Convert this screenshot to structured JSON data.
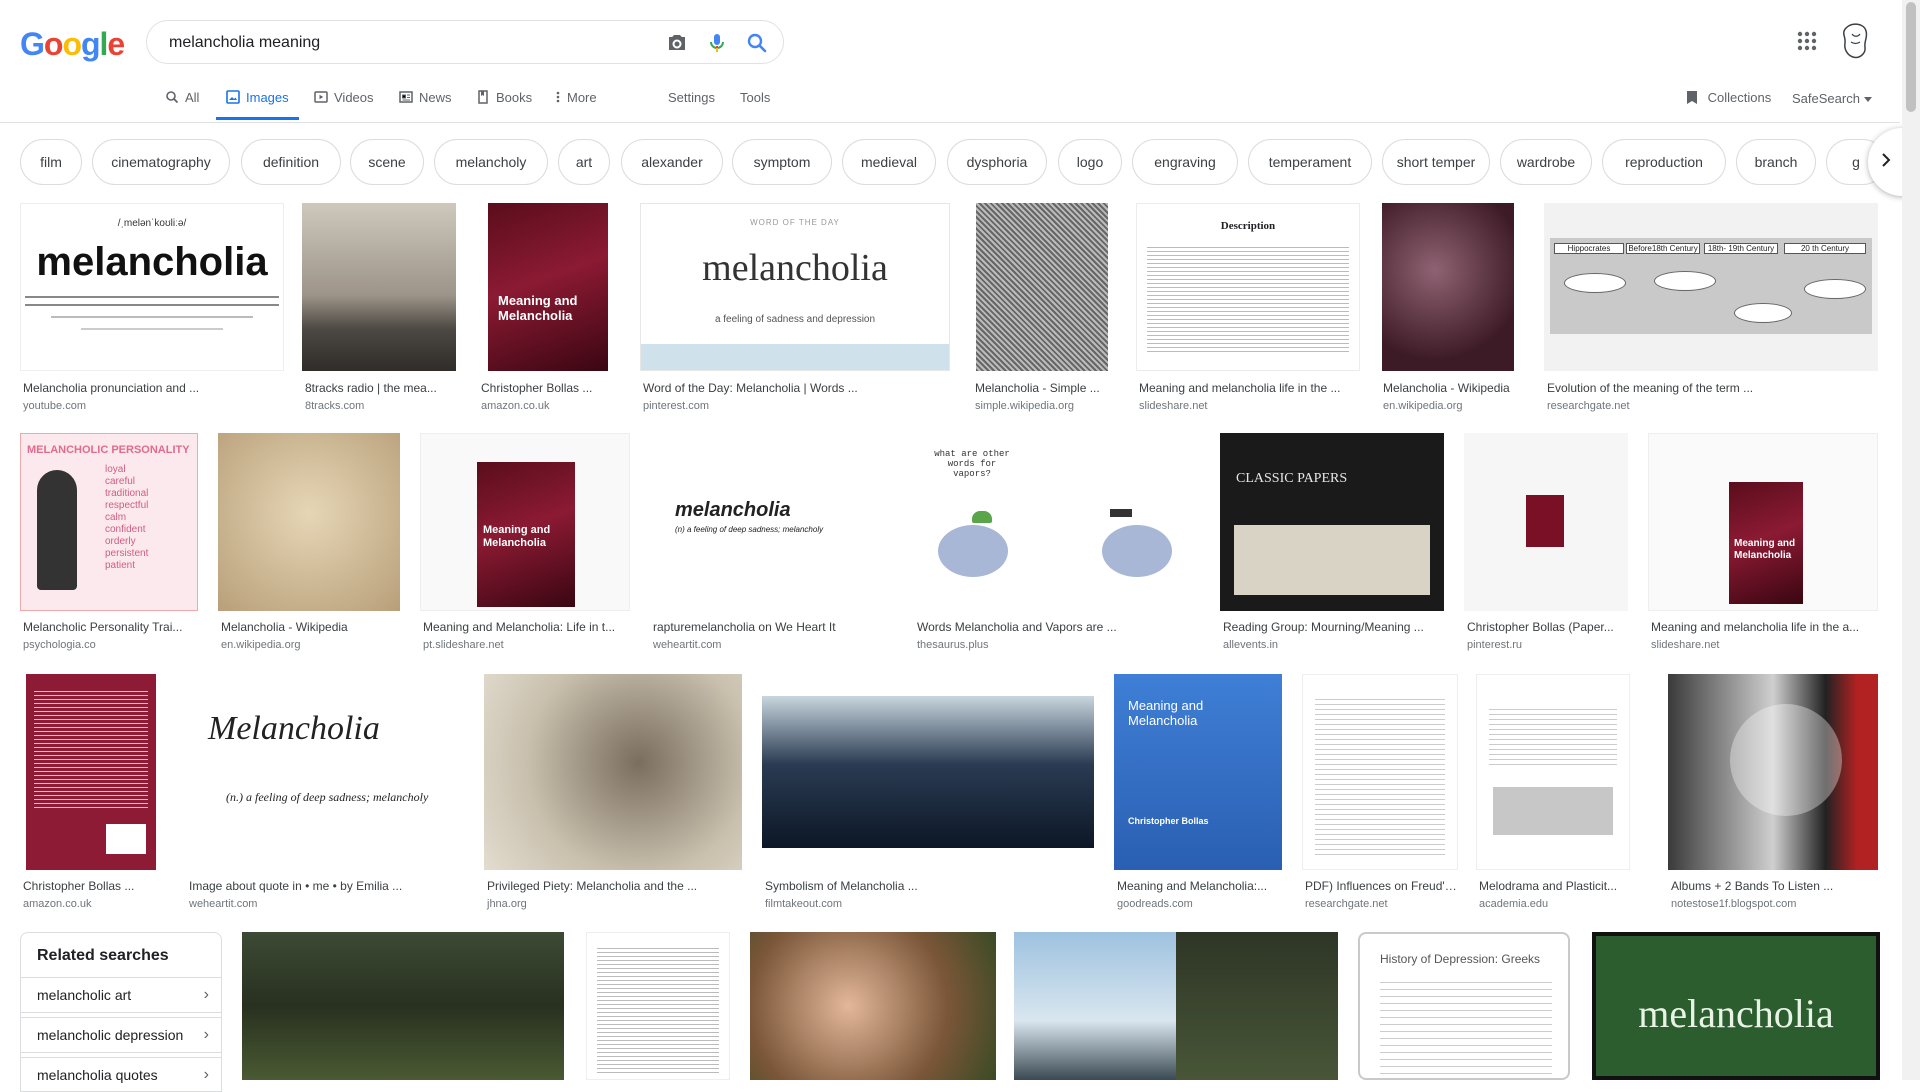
{
  "header": {
    "logo_letters": [
      "G",
      "o",
      "o",
      "g",
      "l",
      "e"
    ],
    "logo_colors": [
      "#4285f4",
      "#ea4335",
      "#fbbc05",
      "#4285f4",
      "#34a853",
      "#ea4335"
    ],
    "search_value": "melancholia meaning",
    "tabs": [
      {
        "label": "All",
        "icon": "search-icon"
      },
      {
        "label": "Images",
        "icon": "image-icon",
        "active": true
      },
      {
        "label": "Videos",
        "icon": "video-icon"
      },
      {
        "label": "News",
        "icon": "news-icon"
      },
      {
        "label": "Books",
        "icon": "book-icon"
      },
      {
        "label": "More",
        "icon": "more-vert-icon"
      }
    ],
    "settings": "Settings",
    "tools": "Tools",
    "collections": "Collections",
    "safesearch": "SafeSearch"
  },
  "chips": [
    "film",
    "cinematography",
    "definition",
    "scene",
    "melancholy",
    "art",
    "alexander",
    "symptom",
    "medieval",
    "dysphoria",
    "logo",
    "engraving",
    "temperament",
    "short temper",
    "wardrobe",
    "reproduction",
    "branch",
    "g"
  ],
  "images": [
    {
      "caption": "Melancholia pronunciation and ...",
      "source": "youtube.com",
      "thumb_text": "melancholia",
      "thumb_sub": "/ˌmelənˈkoʊliːə/"
    },
    {
      "caption": "8tracks radio | the mea...",
      "source": "8tracks.com"
    },
    {
      "caption": "Christopher Bollas ...",
      "source": "amazon.co.uk",
      "thumb_text": "Meaning and Melancholia"
    },
    {
      "caption": "Word of the Day: Melancholia | Words ...",
      "source": "pinterest.com",
      "thumb_text": "melancholia",
      "thumb_sub": "a feeling of sadness and depression",
      "thumb_top": "WORD OF THE DAY"
    },
    {
      "caption": "Melancholia - Simple ...",
      "source": "simple.wikipedia.org"
    },
    {
      "caption": "Meaning and melancholia life in the ...",
      "source": "slideshare.net",
      "thumb_text": "Description"
    },
    {
      "caption": "Melancholia - Wikipedia",
      "source": "en.wikipedia.org"
    },
    {
      "caption": "Evolution of the meaning of the term ...",
      "source": "researchgate.net",
      "thumb_boxes": [
        "Hippocrates",
        "Before18th Century",
        "18th- 19th Century",
        "20 th Century"
      ]
    },
    {
      "caption": "Melancholic Personality Trai...",
      "source": "psychologia.co",
      "thumb_text": "MELANCHOLIC PERSONALITY",
      "thumb_list": [
        "loyal",
        "careful",
        "traditional",
        "respectful",
        "calm",
        "confident",
        "orderly",
        "persistent",
        "patient"
      ]
    },
    {
      "caption": "Melancholia - Wikipedia",
      "source": "en.wikipedia.org"
    },
    {
      "caption": "Meaning and Melancholia: Life in t...",
      "source": "pt.slideshare.net",
      "thumb_text": "Meaning and Melancholia"
    },
    {
      "caption": "rapturemelancholia on We Heart It",
      "source": "weheartit.com",
      "thumb_text": "melancholia",
      "thumb_sub": "(n) a feeling of deep sadness; melancholy"
    },
    {
      "caption": "Words Melancholia and Vapors are ...",
      "source": "thesaurus.plus",
      "thumb_text": "what are other words for vapors?"
    },
    {
      "caption": "Reading Group: Mourning/Meaning ...",
      "source": "allevents.in",
      "thumb_text": "CLASSIC PAPERS"
    },
    {
      "caption": "Christopher Bollas (Paper...",
      "source": "pinterest.ru"
    },
    {
      "caption": "Meaning and melancholia life in the a...",
      "source": "slideshare.net",
      "thumb_text": "Meaning and Melancholia"
    },
    {
      "caption": "Christopher Bollas ...",
      "source": "amazon.co.uk"
    },
    {
      "caption": "Image about quote in • me • by Emilia ...",
      "source": "weheartit.com",
      "thumb_text": "Melancholia",
      "thumb_sub": "(n.) a feeling of deep sadness; melancholy"
    },
    {
      "caption": "Privileged Piety: Melancholia and the ...",
      "source": "jhna.org"
    },
    {
      "caption": "Symbolism of Melancholia ...",
      "source": "filmtakeout.com"
    },
    {
      "caption": "Meaning and Melancholia:...",
      "source": "goodreads.com",
      "thumb_text": "Meaning and Melancholia",
      "thumb_sub": "Christopher Bollas"
    },
    {
      "caption": "PDF) Influences on Freud's...",
      "source": "researchgate.net"
    },
    {
      "caption": "Melodrama and Plasticit...",
      "source": "academia.edu"
    },
    {
      "caption": "Albums + 2 Bands To Listen ...",
      "source": "notestose1f.blogspot.com"
    },
    {
      "caption": "",
      "source": ""
    },
    {
      "caption": "",
      "source": ""
    },
    {
      "caption": "",
      "source": ""
    },
    {
      "caption": "",
      "source": ""
    },
    {
      "caption": "",
      "source": "",
      "thumb_text": "History of Depression: Greeks"
    },
    {
      "caption": "",
      "source": "",
      "thumb_text": "melancholia"
    }
  ],
  "related": {
    "title": "Related searches",
    "items": [
      "melancholic art",
      "melancholic depression",
      "melancholia quotes"
    ]
  },
  "colors": {
    "accent": "#1a73e8",
    "chip_border": "#dadce0",
    "muted": "#5f6368"
  }
}
